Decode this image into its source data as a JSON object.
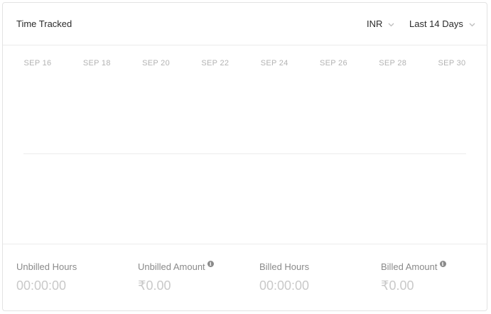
{
  "header": {
    "title": "Time Tracked",
    "currency": "INR",
    "range": "Last 14 Days"
  },
  "chart_data": {
    "type": "line",
    "categories": [
      "SEP 16",
      "SEP 18",
      "SEP 20",
      "SEP 22",
      "SEP 24",
      "SEP 26",
      "SEP 28",
      "SEP 30"
    ],
    "series": [],
    "grid": false
  },
  "stats": [
    {
      "label": "Unbilled Hours",
      "value": "00:00:00",
      "info": false
    },
    {
      "label": "Unbilled Amount",
      "value": "₹0.00",
      "info": true
    },
    {
      "label": "Billed Hours",
      "value": "00:00:00",
      "info": false
    },
    {
      "label": "Billed Amount",
      "value": "₹0.00",
      "info": true
    }
  ],
  "colors": {
    "text": "#2b2b2b",
    "muted": "#8a8a8a",
    "value": "#c9c9c9",
    "border": "#ececec"
  }
}
